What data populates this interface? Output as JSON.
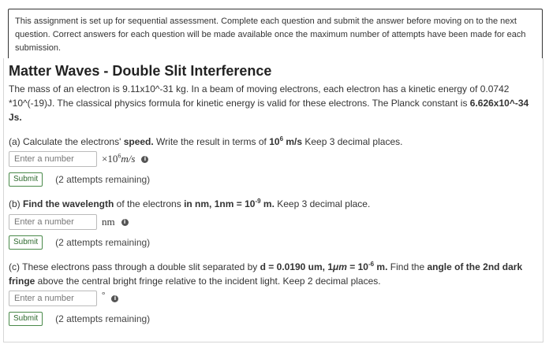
{
  "notice": {
    "text": "This assignment is set up for sequential assessment. Complete each question and submit the answer before moving on to the next question. Correct answers for each question will be made available once the maximum number of attempts have been made for each submission."
  },
  "problem": {
    "title": "Matter Waves - Double Slit Interference",
    "intro_1": "The mass of an electron is 9.11x10^-31 kg",
    "intro_2": ". In a beam of moving electrons, each electron has a kinetic energy of 0.0742 *10^(-19)J. The  classical physics formula for kinetic energy is valid for these electrons. The Planck constant is ",
    "intro_3": "6.626x10^-34 Js."
  },
  "parts": [
    {
      "q_pre": "(a) Calculate the electrons' ",
      "q_b1": "speed.",
      "q_mid": " Write the result in terms of ",
      "q_b2": "10",
      "q_sup": "6",
      "q_b3": " m/s",
      "q_post": "  Keep 3 decimal places.",
      "placeholder": "Enter a number",
      "unit_pre": "×10",
      "unit_sup": "6",
      "unit_post": "m/s",
      "submit": "Submit",
      "remaining": "(2 attempts remaining)",
      "info": "i"
    },
    {
      "q_pre": "(b) ",
      "q_b1": "Find the wavelength",
      "q_mid": " of the electrons ",
      "q_b2": "in nm, 1nm = 10",
      "q_sup": "-9",
      "q_b3": " m.",
      "q_post": " Keep 3 decimal place.",
      "placeholder": "Enter a number",
      "unit": "nm",
      "submit": "Submit",
      "remaining": "(2 attempts remaining)",
      "info": "i"
    },
    {
      "q_pre": "(c) These electrons pass through a double slit separated by ",
      "q_b1": "d = 0.0190 um, 1",
      "q_mu": "μm",
      "q_b2": " = 10",
      "q_sup": "-6",
      "q_b3": " m.",
      "q_mid": " Find the ",
      "q_b4": "angle of the 2nd dark fringe",
      "q_post": " above the central bright fringe relative to the incident light. Keep 2 decimal places.",
      "placeholder": "Enter a number",
      "unit": "°",
      "submit": "Submit",
      "remaining": "(2 attempts remaining)",
      "info": "i"
    }
  ]
}
